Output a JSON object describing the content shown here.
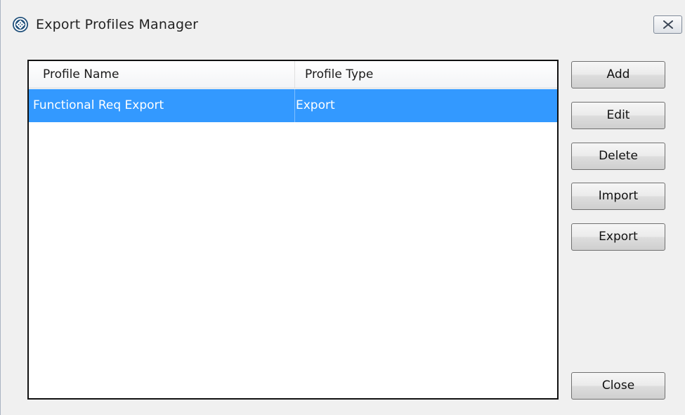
{
  "window": {
    "title": "Export Profiles Manager",
    "icon": "app-logo-icon",
    "close_icon": "close-icon"
  },
  "list": {
    "columns": [
      "Profile Name",
      "Profile Type"
    ],
    "rows": [
      {
        "name": "Functional Req Export",
        "type": "Export",
        "selected": true
      }
    ]
  },
  "buttons": {
    "add": "Add",
    "edit": "Edit",
    "delete": "Delete",
    "import": "Import",
    "export": "Export",
    "close": "Close"
  },
  "colors": {
    "selection": "#3399ff",
    "window_bg": "#f0f0f0"
  }
}
